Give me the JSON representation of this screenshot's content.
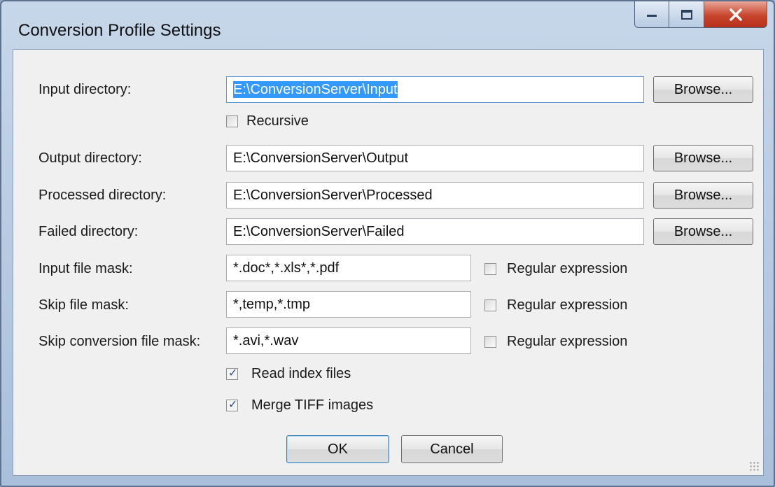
{
  "window": {
    "title": "Conversion Profile Settings",
    "min_icon": "minimize-icon",
    "max_icon": "maximize-icon",
    "close_icon": "close-icon"
  },
  "fields": {
    "input_dir": {
      "label": "Input directory:",
      "value": "E:\\ConversionServer\\Input",
      "browse": "Browse..."
    },
    "recursive": {
      "label": "Recursive",
      "checked": false
    },
    "output_dir": {
      "label": "Output directory:",
      "value": "E:\\ConversionServer\\Output",
      "browse": "Browse..."
    },
    "processed_dir": {
      "label": "Processed directory:",
      "value": "E:\\ConversionServer\\Processed",
      "browse": "Browse..."
    },
    "failed_dir": {
      "label": "Failed directory:",
      "value": "E:\\ConversionServer\\Failed",
      "browse": "Browse..."
    },
    "input_mask": {
      "label": "Input file mask:",
      "value": "*.doc*,*.xls*,*.pdf",
      "regex_label": "Regular expression",
      "regex_checked": false
    },
    "skip_mask": {
      "label": "Skip file mask:",
      "value": "*,temp,*.tmp",
      "regex_label": "Regular expression",
      "regex_checked": false
    },
    "skip_conv_mask": {
      "label": "Skip conversion file mask:",
      "value": "*.avi,*.wav",
      "regex_label": "Regular expression",
      "regex_checked": false
    },
    "read_index": {
      "label": "Read index files",
      "checked": true
    },
    "merge_tiff": {
      "label": "Merge TIFF images",
      "checked": true
    }
  },
  "buttons": {
    "ok": "OK",
    "cancel": "Cancel"
  },
  "colors": {
    "accent": "#3399ff",
    "close": "#c8452e"
  }
}
